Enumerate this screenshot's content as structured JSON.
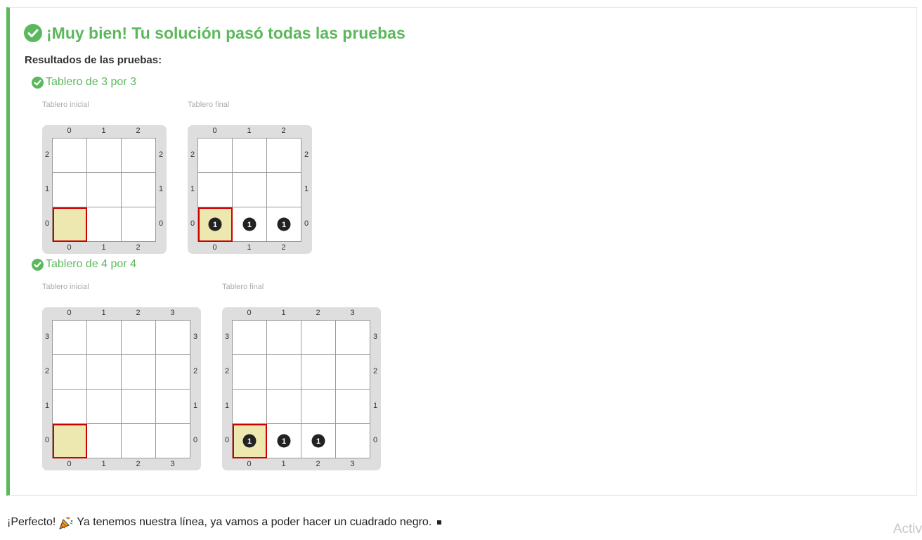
{
  "result": {
    "title": "¡Muy bien! Tu solución pasó todas las pruebas",
    "results_label": "Resultados de las pruebas:",
    "status_color": "#5cb85c"
  },
  "tests": [
    {
      "title": "Tablero de 3 por 3",
      "initial_caption": "Tablero inicial",
      "final_caption": "Tablero final",
      "size": 3,
      "columns": [
        "0",
        "1",
        "2"
      ],
      "rows": [
        "2",
        "1",
        "0"
      ],
      "head": {
        "x": 0,
        "y": 0
      },
      "final_balls": [
        {
          "x": 0,
          "y": 0,
          "count": "1"
        },
        {
          "x": 1,
          "y": 0,
          "count": "1"
        },
        {
          "x": 2,
          "y": 0,
          "count": "1"
        }
      ]
    },
    {
      "title": "Tablero de 4 por 4",
      "initial_caption": "Tablero inicial",
      "final_caption": "Tablero final",
      "size": 4,
      "columns": [
        "0",
        "1",
        "2",
        "3"
      ],
      "rows": [
        "3",
        "2",
        "1",
        "0"
      ],
      "head": {
        "x": 0,
        "y": 0
      },
      "final_balls": [
        {
          "x": 0,
          "y": 0,
          "count": "1"
        },
        {
          "x": 1,
          "y": 0,
          "count": "1"
        },
        {
          "x": 2,
          "y": 0,
          "count": "1"
        }
      ]
    }
  ],
  "footer": {
    "text": "¡Perfecto!",
    "text2": "Ya tenemos nuestra línea, ya vamos a poder hacer un cuadrado negro.",
    "icon": "party-popper-icon"
  },
  "watermark": "Activ"
}
